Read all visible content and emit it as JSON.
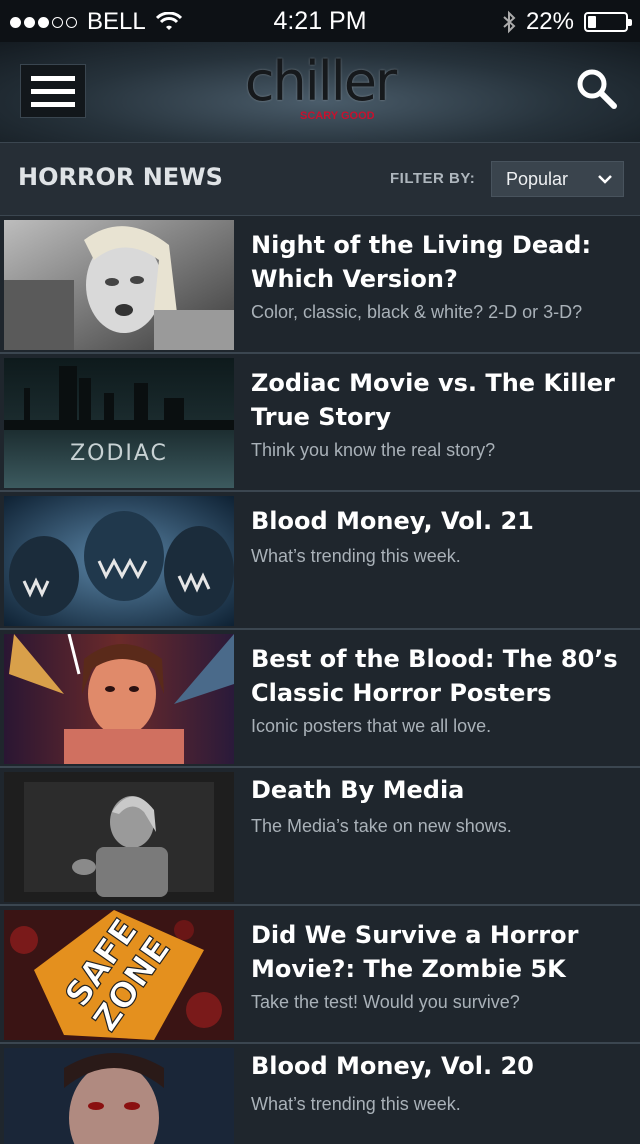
{
  "status_bar": {
    "carrier": "BELL",
    "time": "4:21 PM",
    "battery": "22%",
    "battery_level": 0.22,
    "signal_bars": 3,
    "signal_total": 5
  },
  "header": {
    "logo_text": "chiller",
    "logo_tagline": "SCARY GOOD",
    "menu_icon": "hamburger-menu-icon",
    "search_icon": "search-icon"
  },
  "section": {
    "title": "HORROR NEWS",
    "filter_label": "FILTER BY:",
    "filter_value": "Popular"
  },
  "articles": [
    {
      "title_lines": [
        "Night of the Living Dead:",
        "Which Version?"
      ],
      "description": "Color, classic, black & white? 2-D or 3-D?"
    },
    {
      "title_lines": [
        "Zodiac Movie vs. The Killer",
        "True Story"
      ],
      "description": "Think you know the real story?",
      "thumb_text": "ZODIAC"
    },
    {
      "title_lines": [
        "Blood Money, Vol. 21"
      ],
      "description": "What’s trending this week."
    },
    {
      "title_lines": [
        "Best of the Blood: The 80’s",
        "Classic Horror Posters"
      ],
      "description": "Iconic posters that we all love."
    },
    {
      "title_lines": [
        "Death By Media"
      ],
      "description": "The Media’s take on new shows."
    },
    {
      "title_lines": [
        "Did We Survive a Horror",
        "Movie?: The Zombie 5K"
      ],
      "description": "Take the test! Would you survive?",
      "thumb_text_lines": [
        "SAFE",
        "ZONE"
      ]
    },
    {
      "title_lines": [
        "Blood Money, Vol. 20"
      ],
      "description": "What’s trending this week."
    }
  ],
  "colors": {
    "accent_red": "#c8102e",
    "background": "#1f252c"
  }
}
